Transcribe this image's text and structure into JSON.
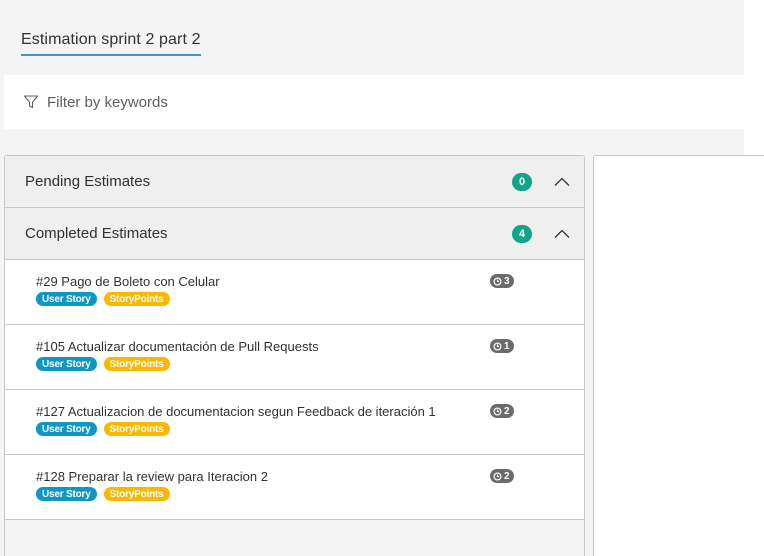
{
  "page": {
    "title": "Estimation sprint 2 part 2"
  },
  "filter": {
    "placeholder": "Filter by keywords",
    "icon": "filter-icon"
  },
  "sections": {
    "pending": {
      "label": "Pending Estimates",
      "count": "0"
    },
    "completed": {
      "label": "Completed Estimates",
      "count": "4",
      "items": [
        {
          "title": "#29 Pago de Boleto con Celular",
          "type_tag": "User Story",
          "field_tag": "StoryPoints",
          "estimate": "3"
        },
        {
          "title": "#105 Actualizar documentación de Pull Requests",
          "type_tag": "User Story",
          "field_tag": "StoryPoints",
          "estimate": "1"
        },
        {
          "title": "#127 Actualizacion de documentacion segun Feedback de iteración 1",
          "type_tag": "User Story",
          "field_tag": "StoryPoints",
          "estimate": "2"
        },
        {
          "title": "#128 Preparar la review para Iteracion 2",
          "type_tag": "User Story",
          "field_tag": "StoryPoints",
          "estimate": "2"
        }
      ]
    }
  },
  "colors": {
    "count_badge": "#10a58c",
    "user_story_tag": "#0f97c3",
    "storypoints_tag": "#f8b800",
    "estimate_badge": "#6b6b6b",
    "tab_underline": "#4a8fc2"
  }
}
